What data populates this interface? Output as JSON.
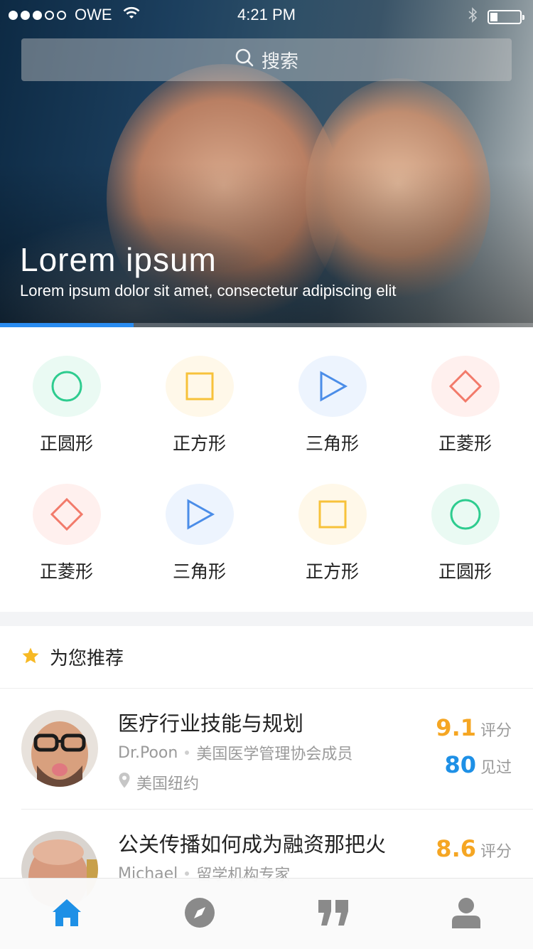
{
  "status_bar": {
    "carrier": "OWE",
    "time": "4:21 PM",
    "signal_dots_filled": 3,
    "signal_dots_total": 5,
    "wifi_icon": "wifi-icon",
    "bluetooth_icon": "bluetooth-icon",
    "battery_level": 0.2
  },
  "search": {
    "placeholder": "搜索",
    "icon": "search-icon"
  },
  "hero": {
    "title": "Lorem ipsum",
    "subtitle": "Lorem ipsum dolor sit amet, consectetur adipiscing elit",
    "carousel_progress": 0.25
  },
  "categories": [
    {
      "label": "正圆形",
      "shape": "circle-icon",
      "color": "#2ecc8f",
      "bg": "#eafaf3"
    },
    {
      "label": "正方形",
      "shape": "square-icon",
      "color": "#f7c23a",
      "bg": "#fff8e9"
    },
    {
      "label": "三角形",
      "shape": "triangle-icon",
      "color": "#4b8de8",
      "bg": "#edf4fe"
    },
    {
      "label": "正菱形",
      "shape": "diamond-icon",
      "color": "#f27a6a",
      "bg": "#fff0ee"
    },
    {
      "label": "正菱形",
      "shape": "diamond-icon",
      "color": "#f27a6a",
      "bg": "#fff0ee"
    },
    {
      "label": "三角形",
      "shape": "triangle-icon",
      "color": "#4b8de8",
      "bg": "#edf4fe"
    },
    {
      "label": "正方形",
      "shape": "square-icon",
      "color": "#f7c23a",
      "bg": "#fff8e9"
    },
    {
      "label": "正圆形",
      "shape": "circle-icon",
      "color": "#2ecc8f",
      "bg": "#eafaf3"
    }
  ],
  "recommend": {
    "title": "为您推荐",
    "icon": "star-icon",
    "items": [
      {
        "title": "医疗行业技能与规划",
        "author": "Dr.Poon",
        "role": "美国医学管理协会成员",
        "location": "美国纽约",
        "score": "9.1",
        "score_label": "评分",
        "seen": "80",
        "seen_label": "见过"
      },
      {
        "title": "公关传播如何成为融资那把火",
        "author": "Michael",
        "role": "留学机构专家",
        "score": "8.6",
        "score_label": "评分"
      }
    ]
  },
  "tab_bar": [
    {
      "name": "home",
      "icon": "home-icon",
      "active": true
    },
    {
      "name": "discover",
      "icon": "compass-icon",
      "active": false
    },
    {
      "name": "quotes",
      "icon": "quote-icon",
      "active": false
    },
    {
      "name": "profile",
      "icon": "user-icon",
      "active": false
    }
  ],
  "colors": {
    "accent_blue": "#1e90e6",
    "score_orange": "#f5a623",
    "star_yellow": "#f7b924",
    "inactive_gray": "#8a8a8a"
  }
}
